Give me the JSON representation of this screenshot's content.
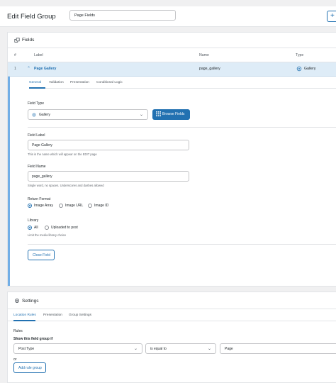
{
  "header": {
    "title": "Edit Field Group",
    "group_name": "Page Fields",
    "add_label": "+"
  },
  "fields_panel": {
    "title": "Fields",
    "columns": [
      "#",
      "Label",
      "Name",
      "Type"
    ],
    "row": {
      "num": "1",
      "label": "Page Gallery",
      "name": "page_gallery",
      "type": "Gallery"
    }
  },
  "field_settings": {
    "tabs": [
      "General",
      "Validation",
      "Presentation",
      "Conditional Logic"
    ],
    "field_type_label": "Field Type",
    "field_type_value": "Gallery",
    "browse_label": "Browse Fields",
    "field_label_label": "Field Label",
    "field_label_value": "Page Gallery",
    "field_label_hint": "This is the name which will appear on the EDIT page",
    "field_name_label": "Field Name",
    "field_name_value": "page_gallery",
    "field_name_hint": "Single word, no spaces. Underscores and dashes allowed",
    "return_format_label": "Return Format",
    "return_format_options": [
      "Image Array",
      "Image URL",
      "Image ID"
    ],
    "return_format_selected": 0,
    "library_label": "Library",
    "library_options": [
      "All",
      "Uploaded to post"
    ],
    "library_selected": 0,
    "library_hint": "Limit the media library choice",
    "close_label": "Close Field"
  },
  "settings_panel": {
    "title": "Settings",
    "tabs": [
      "Location Rules",
      "Presentation",
      "Group Settings"
    ],
    "rules_label": "Rules",
    "show_if_label": "Show this field group if",
    "rule_param": "Post Type",
    "rule_operator": "is equal to",
    "rule_value": "Page",
    "or_label": "or",
    "add_rule_group_label": "Add rule group"
  },
  "colors": {
    "accent": "#2271b1",
    "row_highlight": "#deecf7",
    "border": "#e2e4e7"
  }
}
